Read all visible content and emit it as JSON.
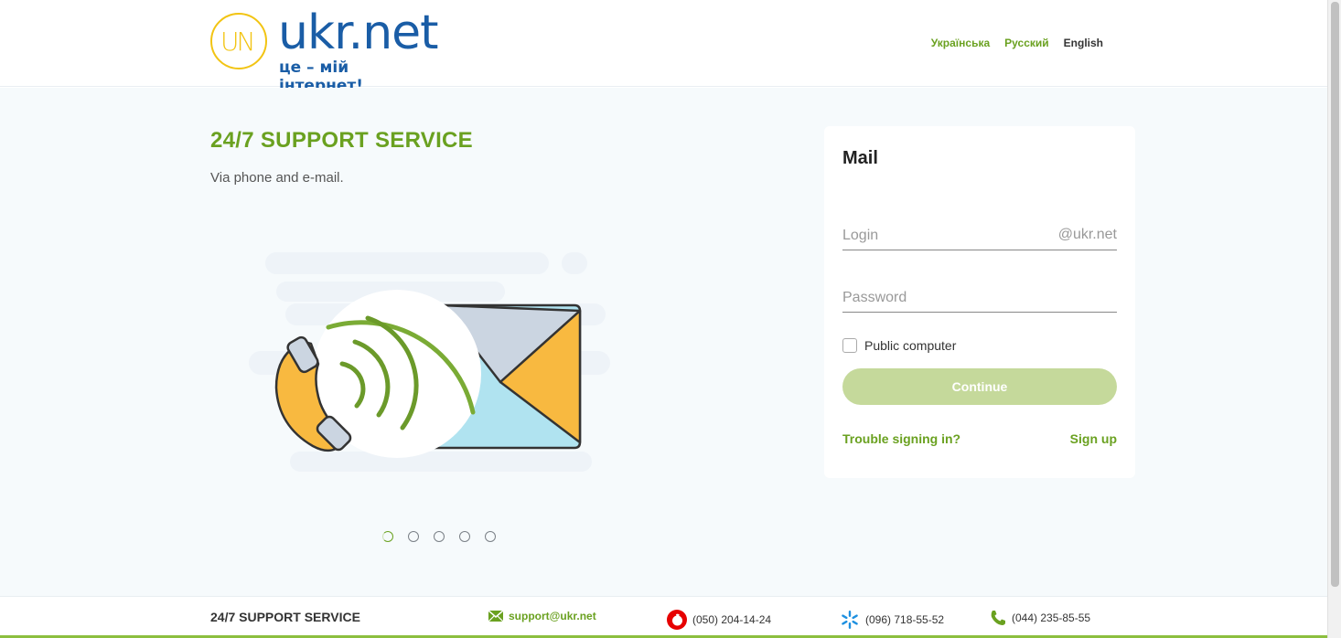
{
  "header": {
    "logo": {
      "mark": "UN",
      "name": "ukr.net",
      "slogan": "це – мій інтернет!"
    },
    "languages": [
      {
        "label": "Українська",
        "active": false
      },
      {
        "label": "Русский",
        "active": false
      },
      {
        "label": "English",
        "active": true
      }
    ]
  },
  "promo": {
    "title": "24/7 SUPPORT SERVICE",
    "subtitle": "Via phone and e-mail.",
    "slides_count": 5,
    "active_slide": 1
  },
  "login_card": {
    "title": "Mail",
    "login_placeholder": "Login",
    "login_suffix": "@ukr.net",
    "password_placeholder": "Password",
    "public_computer_label": "Public computer",
    "public_computer_checked": false,
    "continue_label": "Continue",
    "trouble_label": "Trouble signing in?",
    "signup_label": "Sign up"
  },
  "footer": {
    "title": "24/7 SUPPORT SERVICE",
    "email": "support@ukr.net",
    "vodafone_phone": "(050) 204-14-24",
    "kyivstar_phone": "(096) 718-55-52",
    "landline_phone": "(044) 235-85-55"
  },
  "colors": {
    "accent_green": "#6aa120",
    "logo_blue": "#1a5da6",
    "logo_yellow": "#f2c413",
    "button_disabled": "#c5d99b"
  }
}
